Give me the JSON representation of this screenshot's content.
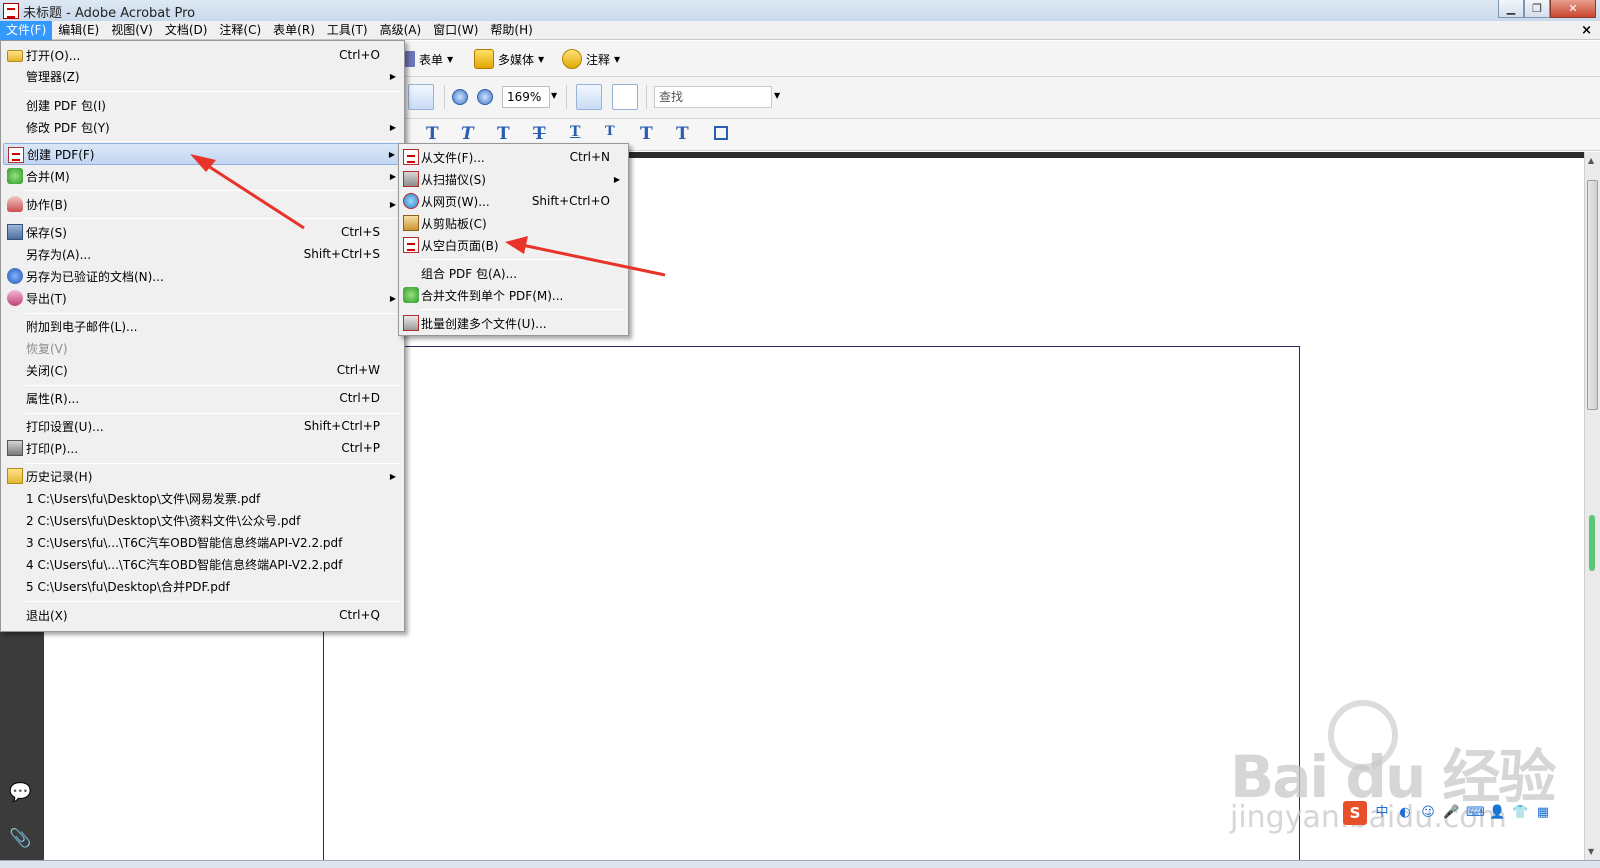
{
  "window": {
    "title": "未标题 - Adobe Acrobat Pro"
  },
  "menubar": {
    "items": [
      "文件(F)",
      "编辑(E)",
      "视图(V)",
      "文档(D)",
      "注释(C)",
      "表单(R)",
      "工具(T)",
      "高级(A)",
      "窗口(W)",
      "帮助(H)"
    ],
    "active_index": 0,
    "doc_close": "×"
  },
  "toolbar": {
    "forms_label": "表单",
    "multimedia_label": "多媒体",
    "comment_label": "注释",
    "zoom_value": "169%",
    "search_placeholder": "查找"
  },
  "file_menu": {
    "items": [
      {
        "label": "打开(O)...",
        "shortcut": "Ctrl+O",
        "icon": "folder-icon"
      },
      {
        "label": "管理器(Z)",
        "submenu": true
      },
      {
        "label": "创建 PDF 包(I)"
      },
      {
        "label": "修改 PDF 包(Y)",
        "submenu": true
      },
      {
        "label": "创建 PDF(F)",
        "submenu": true,
        "icon": "pdf-icon",
        "highlighted": true
      },
      {
        "label": "合并(M)",
        "submenu": true,
        "icon": "combine-icon"
      },
      {
        "label": "协作(B)",
        "submenu": true,
        "icon": "collaborate-icon"
      },
      {
        "label": "保存(S)",
        "shortcut": "Ctrl+S",
        "icon": "save-icon"
      },
      {
        "label": "另存为(A)...",
        "shortcut": "Shift+Ctrl+S"
      },
      {
        "label": "另存为已验证的文档(N)...",
        "icon": "certified-icon"
      },
      {
        "label": "导出(T)",
        "submenu": true,
        "icon": "export-icon"
      },
      {
        "label": "附加到电子邮件(L)..."
      },
      {
        "label": "恢复(V)",
        "disabled": true
      },
      {
        "label": "关闭(C)",
        "shortcut": "Ctrl+W"
      },
      {
        "label": "属性(R)...",
        "shortcut": "Ctrl+D"
      },
      {
        "label": "打印设置(U)...",
        "shortcut": "Shift+Ctrl+P"
      },
      {
        "label": "打印(P)...",
        "shortcut": "Ctrl+P",
        "icon": "print-icon"
      },
      {
        "label": "历史记录(H)",
        "submenu": true,
        "icon": "history-icon"
      },
      {
        "label": "1 C:\\Users\\fu\\Desktop\\文件\\网易发票.pdf"
      },
      {
        "label": "2 C:\\Users\\fu\\Desktop\\文件\\资料文件\\公众号.pdf"
      },
      {
        "label": "3 C:\\Users\\fu\\...\\T6C汽车OBD智能信息终端API-V2.2.pdf"
      },
      {
        "label": "4 C:\\Users\\fu\\...\\T6C汽车OBD智能信息终端API-V2.2.pdf"
      },
      {
        "label": "5 C:\\Users\\fu\\Desktop\\合并PDF.pdf"
      },
      {
        "label": "退出(X)",
        "shortcut": "Ctrl+Q"
      }
    ]
  },
  "create_pdf_submenu": {
    "items": [
      {
        "label": "从文件(F)...",
        "shortcut": "Ctrl+N",
        "icon": "from-file-icon"
      },
      {
        "label": "从扫描仪(S)",
        "submenu": true,
        "icon": "scanner-icon"
      },
      {
        "label": "从网页(W)...",
        "shortcut": "Shift+Ctrl+O",
        "icon": "web-icon"
      },
      {
        "label": "从剪贴板(C)",
        "icon": "clipboard-icon"
      },
      {
        "label": "从空白页面(B)",
        "icon": "blank-page-icon"
      },
      {
        "label": "组合 PDF 包(A)..."
      },
      {
        "label": "合并文件到单个 PDF(M)...",
        "icon": "merge-icon"
      },
      {
        "label": "批量创建多个文件(U)...",
        "icon": "batch-icon"
      }
    ]
  },
  "watermark": {
    "main": "Bai du 经验",
    "sub": "jingyan.baidu.com"
  },
  "colors": {
    "menu_active": "#3399ff",
    "annotation_arrow": "#e8332a",
    "left_rail": "#3b3b3b"
  }
}
